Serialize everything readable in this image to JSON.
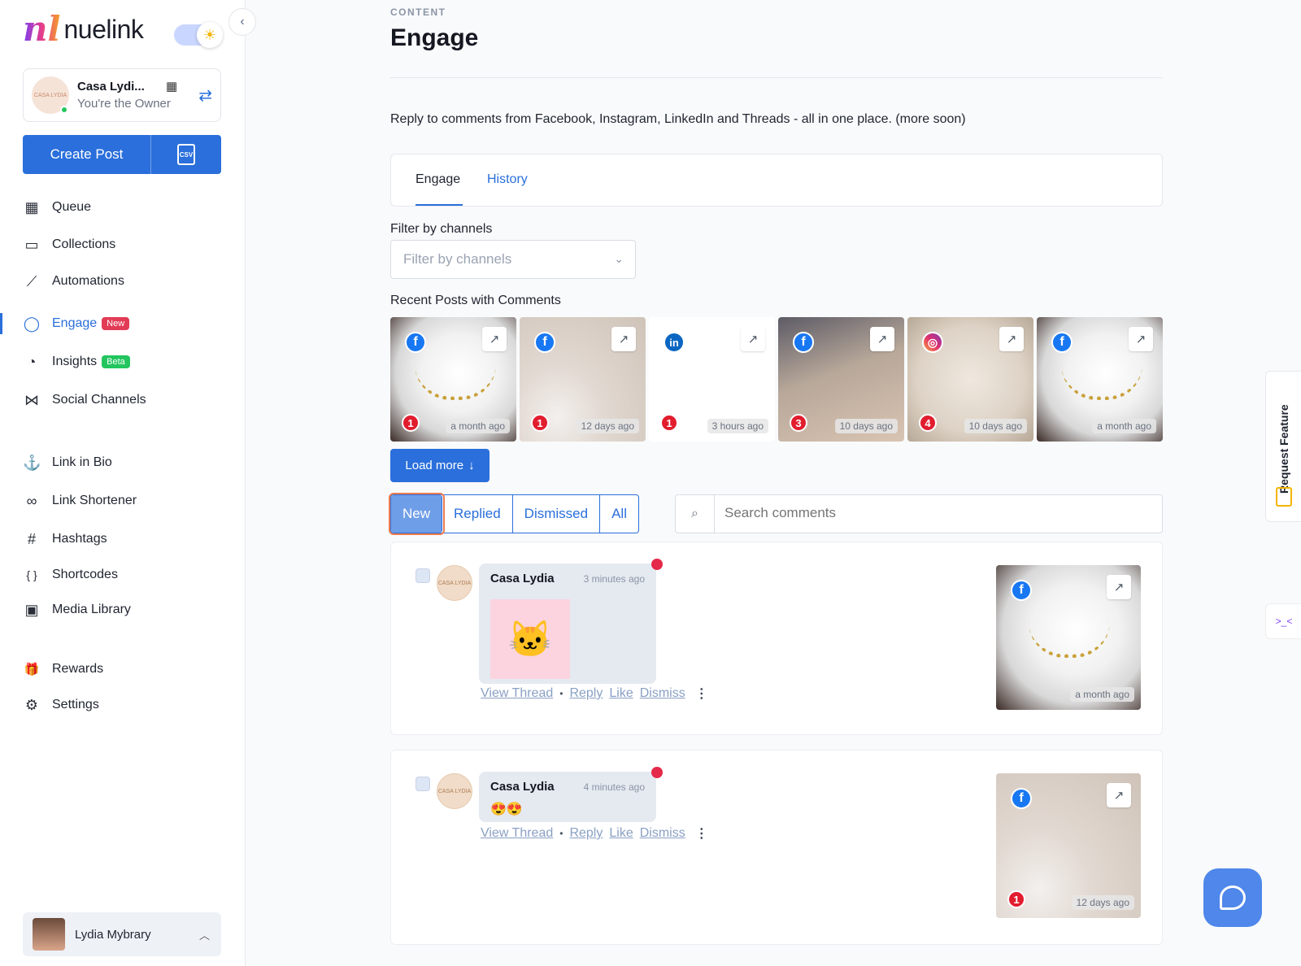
{
  "brand": {
    "logo_mark": "nl",
    "name": "nuelink"
  },
  "account": {
    "name": "Casa Lydi...",
    "role": "You're the Owner",
    "avatar_text": "CASA LYDIA"
  },
  "create_post": {
    "label": "Create Post",
    "csv_label": "CSV"
  },
  "nav": [
    {
      "label": "Queue",
      "icon": "calendar-icon",
      "glyph": "▦"
    },
    {
      "label": "Collections",
      "icon": "folder-icon",
      "glyph": "▭"
    },
    {
      "label": "Automations",
      "icon": "magic-wand-icon",
      "glyph": "⟋"
    },
    {
      "label": "Engage",
      "icon": "chat-bubble-icon",
      "glyph": "◯",
      "badge": "New",
      "active": true
    },
    {
      "label": "Insights",
      "icon": "pie-chart-icon",
      "glyph": "◔",
      "badge": "Beta"
    },
    {
      "label": "Social Channels",
      "icon": "share-icon",
      "glyph": "⋈"
    },
    {
      "label": "Link in Bio",
      "icon": "anchor-icon",
      "glyph": "⚓"
    },
    {
      "label": "Link Shortener",
      "icon": "link-icon",
      "glyph": "∞"
    },
    {
      "label": "Hashtags",
      "icon": "hashtag-icon",
      "glyph": "#"
    },
    {
      "label": "Shortcodes",
      "icon": "braces-icon",
      "glyph": "{ }"
    },
    {
      "label": "Media Library",
      "icon": "image-gallery-icon",
      "glyph": "▣"
    },
    {
      "label": "Rewards",
      "icon": "gift-icon",
      "glyph": "🎁"
    },
    {
      "label": "Settings",
      "icon": "gear-icon",
      "glyph": "⚙"
    }
  ],
  "user": {
    "name": "Lydia Mybrary"
  },
  "page": {
    "crumb": "CONTENT",
    "title": "Engage",
    "description": "Reply to comments from Facebook, Instagram, LinkedIn and Threads - all in one place. (more soon)"
  },
  "tabs": {
    "engage": "Engage",
    "history": "History"
  },
  "filter": {
    "label": "Filter by channels",
    "placeholder": "Filter by channels"
  },
  "recent": {
    "label": "Recent Posts with Comments",
    "posts": [
      {
        "network": "facebook",
        "count": "1",
        "time": "a month ago"
      },
      {
        "network": "facebook",
        "count": "1",
        "time": "12 days ago"
      },
      {
        "network": "linkedin",
        "count": "1",
        "time": "3 hours ago"
      },
      {
        "network": "facebook",
        "count": "3",
        "time": "10 days ago"
      },
      {
        "network": "instagram",
        "count": "4",
        "time": "10 days ago"
      },
      {
        "network": "facebook",
        "count": "",
        "time": "a month ago"
      }
    ]
  },
  "load_more": "Load more",
  "status_filter": {
    "new": "New",
    "replied": "Replied",
    "dismissed": "Dismissed",
    "all": "All",
    "selected": "New"
  },
  "search": {
    "placeholder": "Search comments"
  },
  "comments": [
    {
      "author": "Casa Lydia",
      "time": "3 minutes ago",
      "content_type": "sticker",
      "emoji": "",
      "post_time": "a month ago",
      "post_count": ""
    },
    {
      "author": "Casa Lydia",
      "time": "4 minutes ago",
      "content_type": "text",
      "emoji": "😍😍",
      "post_time": "12 days ago",
      "post_count": "1"
    }
  ],
  "comment_actions": {
    "view_thread": "View Thread",
    "reply": "Reply",
    "like": "Like",
    "dismiss": "Dismiss"
  },
  "request_feature": "Request Feature",
  "colors": {
    "primary": "#2a6fdb",
    "new_badge": "#e23b55",
    "beta_badge": "#22c55e",
    "unread_dot": "#e5294a",
    "selected_outline": "#ee7a4f"
  }
}
